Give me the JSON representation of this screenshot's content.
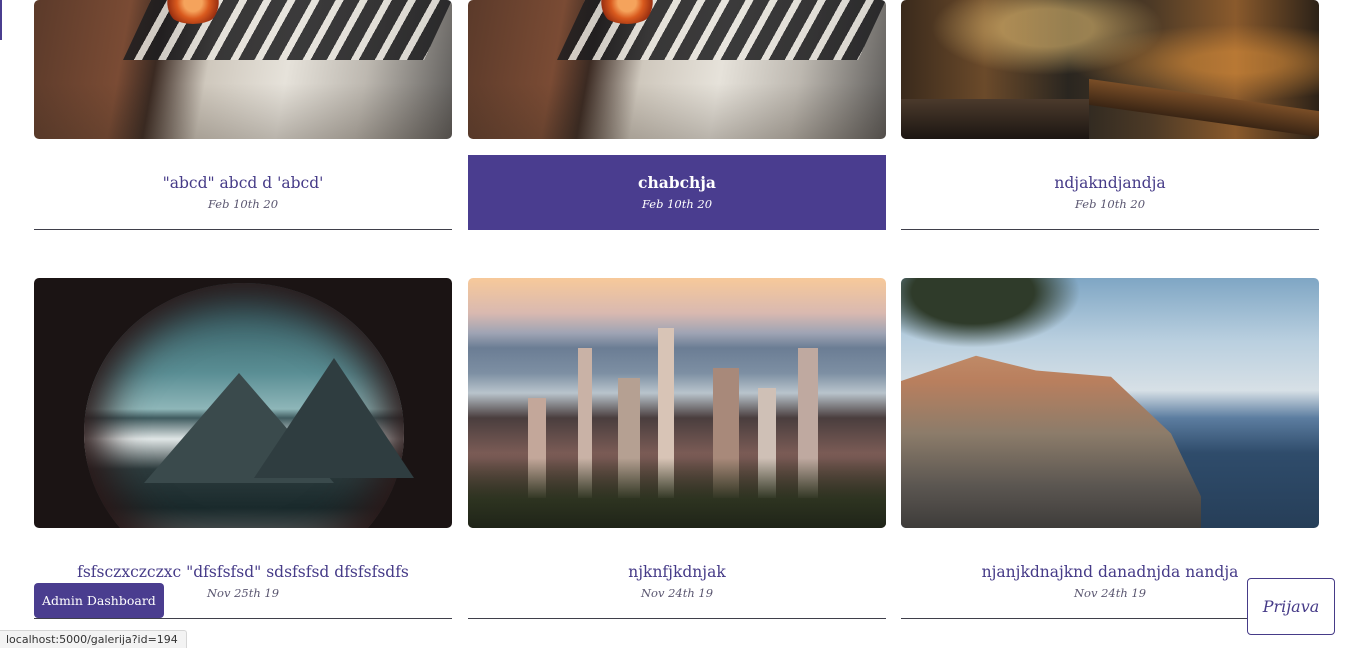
{
  "gallery": {
    "cards": [
      {
        "title": "\"abcd\" abcd d 'abcd'",
        "date": "Feb 10th 20",
        "image": "piano-flower-photo",
        "active": false
      },
      {
        "title": "chabchja",
        "date": "Feb 10th 20",
        "image": "piano-flower-photo",
        "active": true
      },
      {
        "title": "ndjakndjandja",
        "date": "Feb 10th 20",
        "image": "bar-interior-photo",
        "active": false
      },
      {
        "title": "fsfsczxczczxc \"dfsfsfsd\" sdsfsfsd dfsfsfsdfs",
        "date": "Nov 25th 19",
        "image": "mountain-porthole-photo",
        "active": false
      },
      {
        "title": "njknfjkdnjak",
        "date": "Nov 24th 19",
        "image": "city-skyline-photo",
        "active": false
      },
      {
        "title": "njanjkdnajknd danadnjda nandja",
        "date": "Nov 24th 19",
        "image": "coastal-village-photo",
        "active": false
      }
    ]
  },
  "admin_button": {
    "label": "Admin Dashboard"
  },
  "login_button": {
    "label": "Prijava"
  },
  "status_bar": {
    "url": "localhost:5000/galerija?id=194"
  },
  "colors": {
    "accent": "#4a3d8f",
    "title_text": "#463b88"
  }
}
